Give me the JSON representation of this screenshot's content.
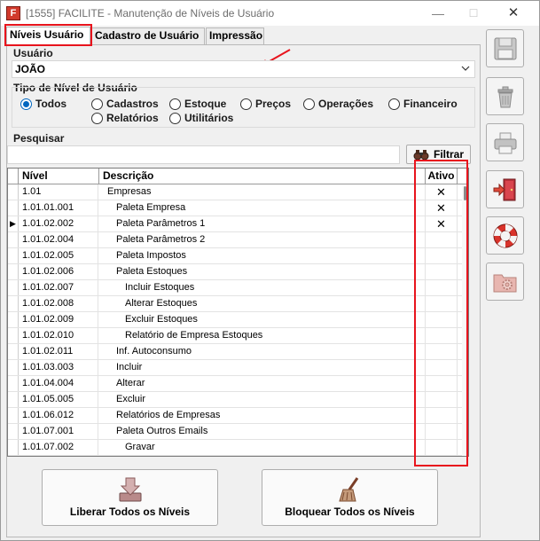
{
  "window": {
    "title": "[1555] FACILITE - Manutenção de Níveis de Usuário",
    "app_icon_letter": "F",
    "controls": {
      "minimize": "—",
      "maximize": "☐",
      "close": "✕"
    }
  },
  "tabs": [
    {
      "label": "Níveis Usuário",
      "active": true
    },
    {
      "label": "Cadastro de Usuário",
      "active": false
    },
    {
      "label": "Impressão",
      "active": false
    }
  ],
  "user": {
    "label": "Usuário",
    "value": "JOÃO"
  },
  "level_type": {
    "label": "Tipo de Nível de Usuário",
    "options": [
      {
        "label": "Todos",
        "checked": true
      },
      {
        "label": "Cadastros",
        "checked": false
      },
      {
        "label": "Estoque",
        "checked": false
      },
      {
        "label": "Preços",
        "checked": false
      },
      {
        "label": "Operações",
        "checked": false
      },
      {
        "label": "Financeiro",
        "checked": false
      },
      {
        "label": "Relatórios",
        "checked": false
      },
      {
        "label": "Utilitários",
        "checked": false
      }
    ]
  },
  "search": {
    "label": "Pesquisar",
    "value": "",
    "filter_button": "Filtrar"
  },
  "grid": {
    "columns": {
      "nivel": "Nível",
      "descricao": "Descrição",
      "ativo": "Ativo"
    },
    "rows": [
      {
        "nivel": "1.01",
        "descricao": "Empresas",
        "indent": 0,
        "ativo": "✕",
        "current": ""
      },
      {
        "nivel": "1.01.01.001",
        "descricao": "Paleta Empresa",
        "indent": 1,
        "ativo": "✕",
        "current": ""
      },
      {
        "nivel": "1.01.02.002",
        "descricao": "Paleta Parâmetros 1",
        "indent": 1,
        "ativo": "✕",
        "current": "▶"
      },
      {
        "nivel": "1.01.02.004",
        "descricao": "Paleta Parâmetros 2",
        "indent": 1,
        "ativo": "",
        "current": ""
      },
      {
        "nivel": "1.01.02.005",
        "descricao": "Paleta Impostos",
        "indent": 1,
        "ativo": "",
        "current": ""
      },
      {
        "nivel": "1.01.02.006",
        "descricao": "Paleta Estoques",
        "indent": 1,
        "ativo": "",
        "current": ""
      },
      {
        "nivel": "1.01.02.007",
        "descricao": "Incluir Estoques",
        "indent": 2,
        "ativo": "",
        "current": ""
      },
      {
        "nivel": "1.01.02.008",
        "descricao": "Alterar Estoques",
        "indent": 2,
        "ativo": "",
        "current": ""
      },
      {
        "nivel": "1.01.02.009",
        "descricao": "Excluir Estoques",
        "indent": 2,
        "ativo": "",
        "current": ""
      },
      {
        "nivel": "1.01.02.010",
        "descricao": "Relatório de Empresa Estoques",
        "indent": 2,
        "ativo": "",
        "current": ""
      },
      {
        "nivel": "1.01.02.011",
        "descricao": "Inf. Autoconsumo",
        "indent": 1,
        "ativo": "",
        "current": ""
      },
      {
        "nivel": "1.01.03.003",
        "descricao": "Incluir",
        "indent": 1,
        "ativo": "",
        "current": ""
      },
      {
        "nivel": "1.01.04.004",
        "descricao": "Alterar",
        "indent": 1,
        "ativo": "",
        "current": ""
      },
      {
        "nivel": "1.01.05.005",
        "descricao": "Excluir",
        "indent": 1,
        "ativo": "",
        "current": ""
      },
      {
        "nivel": "1.01.06.012",
        "descricao": "Relatórios de Empresas",
        "indent": 1,
        "ativo": "",
        "current": ""
      },
      {
        "nivel": "1.01.07.001",
        "descricao": "Paleta Outros Emails",
        "indent": 1,
        "ativo": "",
        "current": ""
      },
      {
        "nivel": "1.01.07.002",
        "descricao": "Gravar",
        "indent": 2,
        "ativo": "",
        "current": ""
      }
    ]
  },
  "actions": {
    "release_all": "Liberar Todos os Níveis",
    "block_all": "Bloquear Todos os Níveis"
  },
  "toolbar": {
    "items": [
      {
        "name": "save",
        "icon": "floppy-disk-icon"
      },
      {
        "name": "delete",
        "icon": "trash-icon"
      },
      {
        "name": "print",
        "icon": "printer-icon"
      },
      {
        "name": "exit",
        "icon": "exit-door-icon"
      },
      {
        "name": "help",
        "icon": "lifebuoy-icon"
      },
      {
        "name": "settings",
        "icon": "folder-gear-icon"
      }
    ]
  },
  "colors": {
    "highlight": "#e8141d",
    "radio_accent": "#0067c0"
  }
}
